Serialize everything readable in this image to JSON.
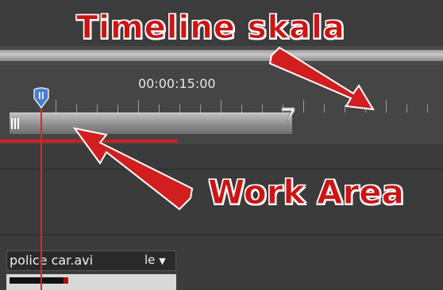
{
  "timeline": {
    "timecode": "00:00:15:00"
  },
  "annotations": {
    "timeline_scale": "Timeline skala",
    "work_area": "Work Area"
  },
  "clip": {
    "name": "police car.avi",
    "mode_fragment": "le",
    "dropdown_icon": "chevron-down-icon"
  },
  "colors": {
    "accent_red": "#cc1414",
    "playhead": "#e02626",
    "render_bar": "#d11f1f",
    "playhead_head": "#4a7fd0"
  }
}
